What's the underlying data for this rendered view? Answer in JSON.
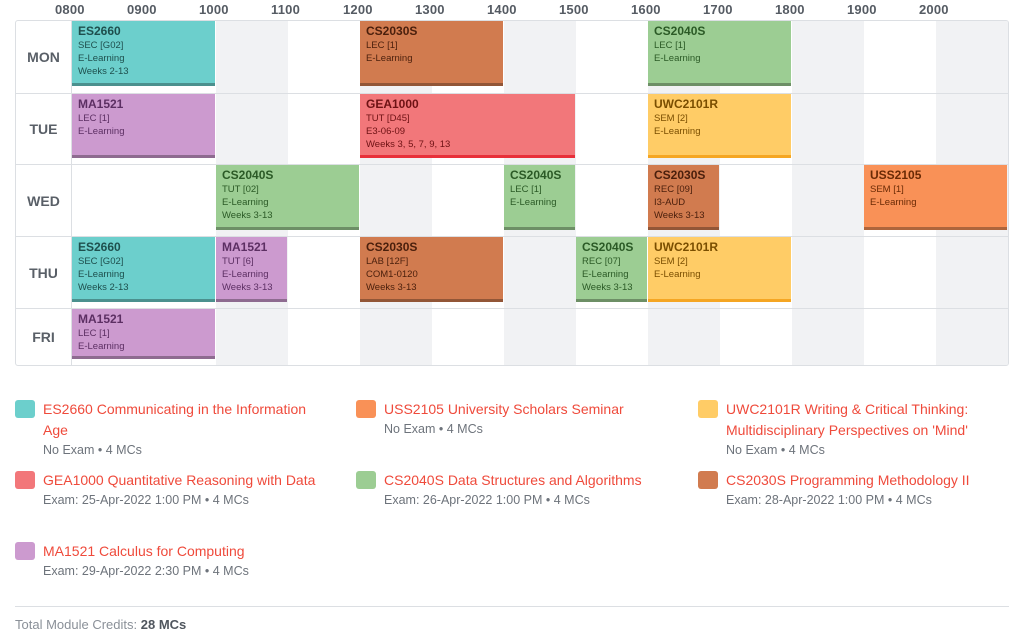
{
  "time_labels": [
    "0800",
    "0900",
    "1000",
    "1100",
    "1200",
    "1300",
    "1400",
    "1500",
    "1600",
    "1700",
    "1800",
    "1900",
    "2000"
  ],
  "days": [
    {
      "label": "MON",
      "lessons": [
        {
          "code": "ES2660",
          "type": "SEC [G02]",
          "venue": "E-Learning",
          "weeks": "Weeks 2-13",
          "start": 8,
          "end": 10,
          "color": "#6ccfcc",
          "text": "#1e4f4d"
        },
        {
          "code": "CS2030S",
          "type": "LEC [1]",
          "venue": "E-Learning",
          "weeks": "",
          "start": 12,
          "end": 14,
          "color": "#d17b4f",
          "text": "#4a1f0c"
        },
        {
          "code": "CS2040S",
          "type": "LEC [1]",
          "venue": "E-Learning",
          "weeks": "",
          "start": 16,
          "end": 18,
          "color": "#9ccd93",
          "text": "#2b5a26"
        }
      ]
    },
    {
      "label": "TUE",
      "lessons": [
        {
          "code": "MA1521",
          "type": "LEC [1]",
          "venue": "E-Learning",
          "weeks": "",
          "start": 8,
          "end": 10,
          "color": "#cc9acf",
          "text": "#5c2f63"
        },
        {
          "code": "GEA1000",
          "type": "TUT [D45]",
          "venue": "E3-06-09",
          "weeks": "Weeks 3, 5, 7, 9, 13",
          "start": 12,
          "end": 15,
          "color": "#f2777a",
          "text": "#6e1214",
          "border": "#e8303a"
        },
        {
          "code": "UWC2101R",
          "type": "SEM [2]",
          "venue": "E-Learning",
          "weeks": "",
          "start": 16,
          "end": 18,
          "color": "#ffcc66",
          "text": "#7a4e00",
          "border": "#f5a623"
        }
      ]
    },
    {
      "label": "WED",
      "lessons": [
        {
          "code": "CS2040S",
          "type": "TUT [02]",
          "venue": "E-Learning",
          "weeks": "Weeks 3-13",
          "start": 10,
          "end": 12,
          "color": "#9ccd93",
          "text": "#2b5a26"
        },
        {
          "code": "CS2040S",
          "type": "LEC [1]",
          "venue": "E-Learning",
          "weeks": "",
          "start": 14,
          "end": 15,
          "color": "#9ccd93",
          "text": "#2b5a26"
        },
        {
          "code": "CS2030S",
          "type": "REC [09]",
          "venue": "I3-AUD",
          "weeks": "Weeks 3-13",
          "start": 16,
          "end": 17,
          "color": "#d17b4f",
          "text": "#4a1f0c"
        },
        {
          "code": "USS2105",
          "type": "SEM [1]",
          "venue": "E-Learning",
          "weeks": "",
          "start": 19,
          "end": 21,
          "color": "#f99157",
          "text": "#6a2a05"
        }
      ]
    },
    {
      "label": "THU",
      "lessons": [
        {
          "code": "ES2660",
          "type": "SEC [G02]",
          "venue": "E-Learning",
          "weeks": "Weeks 2-13",
          "start": 8,
          "end": 10,
          "color": "#6ccfcc",
          "text": "#1e4f4d"
        },
        {
          "code": "MA1521",
          "type": "TUT [6]",
          "venue": "E-Learning",
          "weeks": "Weeks 3-13",
          "start": 10,
          "end": 11,
          "color": "#cc9acf",
          "text": "#5c2f63"
        },
        {
          "code": "CS2030S",
          "type": "LAB [12F]",
          "venue": "COM1-0120",
          "weeks": "Weeks 3-13",
          "start": 12,
          "end": 14,
          "color": "#d17b4f",
          "text": "#4a1f0c"
        },
        {
          "code": "CS2040S",
          "type": "REC [07]",
          "venue": "E-Learning",
          "weeks": "Weeks 3-13",
          "start": 15,
          "end": 16,
          "color": "#9ccd93",
          "text": "#2b5a26"
        },
        {
          "code": "UWC2101R",
          "type": "SEM [2]",
          "venue": "E-Learning",
          "weeks": "",
          "start": 16,
          "end": 18,
          "color": "#ffcc66",
          "text": "#7a4e00",
          "border": "#f5a623"
        }
      ]
    },
    {
      "label": "FRI",
      "lessons": [
        {
          "code": "MA1521",
          "type": "LEC [1]",
          "venue": "E-Learning",
          "weeks": "",
          "start": 8,
          "end": 10,
          "color": "#cc9acf",
          "text": "#5c2f63"
        }
      ]
    }
  ],
  "modules": [
    {
      "title": "ES2660 Communicating in the Information Age",
      "sub": "No Exam • 4 MCs",
      "color": "#6ccfcc"
    },
    {
      "title": "USS2105 University Scholars Seminar",
      "sub": "No Exam • 4 MCs",
      "color": "#f99157"
    },
    {
      "title": "UWC2101R Writing & Critical Thinking: Multidisciplinary Perspectives on 'Mind'",
      "sub": "No Exam • 4 MCs",
      "color": "#ffcc66"
    },
    {
      "title": "GEA1000 Quantitative Reasoning with Data",
      "sub": "Exam: 25-Apr-2022 1:00 PM • 4 MCs",
      "color": "#f2777a"
    },
    {
      "title": "CS2040S Data Structures and Algorithms",
      "sub": "Exam: 26-Apr-2022 1:00 PM • 4 MCs",
      "color": "#9ccd93"
    },
    {
      "title": "CS2030S Programming Methodology II",
      "sub": "Exam: 28-Apr-2022 1:00 PM • 4 MCs",
      "color": "#d17b4f"
    },
    {
      "title": "MA1521 Calculus for Computing",
      "sub": "Exam: 29-Apr-2022 2:30 PM • 4 MCs",
      "color": "#cc9acf"
    }
  ],
  "footer": {
    "label": "Total Module Credits:",
    "value": "28 MCs"
  }
}
